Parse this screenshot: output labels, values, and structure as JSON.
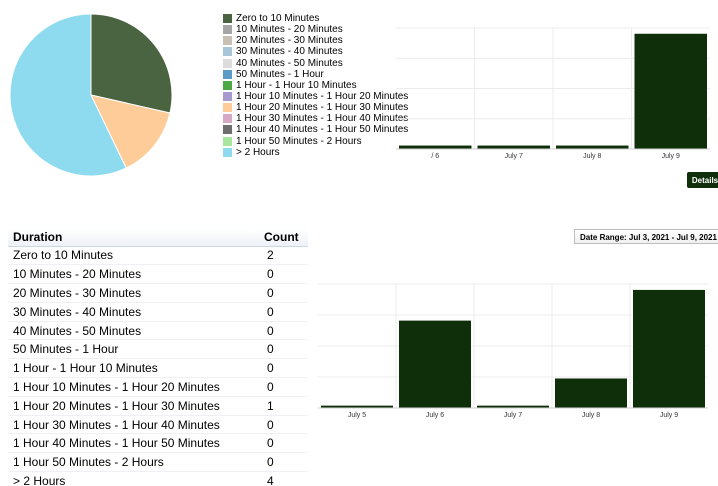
{
  "legend": [
    {
      "label": "Zero to 10 Minutes",
      "color": "#4a6341"
    },
    {
      "label": "10 Minutes - 20 Minutes",
      "color": "#a6a6a6"
    },
    {
      "label": "20 Minutes - 30 Minutes",
      "color": "#c9c0b4"
    },
    {
      "label": "30 Minutes - 40 Minutes",
      "color": "#a9c6d8"
    },
    {
      "label": "40 Minutes - 50 Minutes",
      "color": "#dcdcdc"
    },
    {
      "label": "50 Minutes - 1 Hour",
      "color": "#5b9bc7"
    },
    {
      "label": "1 Hour - 1 Hour 10 Minutes",
      "color": "#4aa845"
    },
    {
      "label": "1 Hour 10 Minutes - 1 Hour 20 Minutes",
      "color": "#a79ad0"
    },
    {
      "label": "1 Hour 20 Minutes - 1 Hour 30 Minutes",
      "color": "#fdcc99"
    },
    {
      "label": "1 Hour 30 Minutes - 1 Hour 40 Minutes",
      "color": "#d5a9c6"
    },
    {
      "label": "1 Hour 40 Minutes - 1 Hour 50 Minutes",
      "color": "#6e6e6e"
    },
    {
      "label": "1 Hour 50 Minutes - 2 Hours",
      "color": "#a8e6a0"
    },
    {
      "label": "> 2 Hours",
      "color": "#8edbf0"
    }
  ],
  "details_label": "Details",
  "table": {
    "headers": {
      "duration": "Duration",
      "count": "Count"
    },
    "rows": [
      {
        "duration": "Zero to 10 Minutes",
        "count": "2"
      },
      {
        "duration": "10 Minutes - 20 Minutes",
        "count": "0"
      },
      {
        "duration": "20 Minutes - 30 Minutes",
        "count": "0"
      },
      {
        "duration": "30 Minutes - 40 Minutes",
        "count": "0"
      },
      {
        "duration": "40 Minutes - 50 Minutes",
        "count": "0"
      },
      {
        "duration": "50 Minutes - 1 Hour",
        "count": "0"
      },
      {
        "duration": "1 Hour - 1 Hour 10 Minutes",
        "count": "0"
      },
      {
        "duration": "1 Hour 10 Minutes - 1 Hour 20 Minutes",
        "count": "0"
      },
      {
        "duration": "1 Hour 20 Minutes - 1 Hour 30 Minutes",
        "count": "1"
      },
      {
        "duration": "1 Hour 30 Minutes - 1 Hour 40 Minutes",
        "count": "0"
      },
      {
        "duration": "1 Hour 40 Minutes - 1 Hour 50 Minutes",
        "count": "0"
      },
      {
        "duration": "1 Hour 50 Minutes - 2 Hours",
        "count": "0"
      },
      {
        "duration": "> 2 Hours",
        "count": "4"
      }
    ]
  },
  "date_range_label": "Date Range: Jul 3, 2021 - Jul 9, 2021",
  "chart_data": [
    {
      "type": "pie",
      "categories": [
        "Zero to 10 Minutes",
        "1 Hour 20 Minutes - 1 Hour 30 Minutes",
        "> 2 Hours"
      ],
      "values": [
        2,
        1,
        4
      ],
      "colors": [
        "#4a6341",
        "#fdcc99",
        "#8edbf0"
      ]
    },
    {
      "type": "bar",
      "categories": [
        "/ 6",
        "July 7",
        "July 8",
        "July 9"
      ],
      "values": [
        0.03,
        0.03,
        0.03,
        1
      ],
      "ylim": [
        0,
        1.05
      ],
      "grid": true,
      "bar_color": "#0f2f0b"
    },
    {
      "type": "bar",
      "categories": [
        "July 5",
        "July 6",
        "July 7",
        "July 8",
        "July 9"
      ],
      "values": [
        0.02,
        0.74,
        0.02,
        0.25,
        1
      ],
      "ylim": [
        0,
        1.05
      ],
      "grid": true,
      "bar_color": "#0f2f0b"
    }
  ]
}
